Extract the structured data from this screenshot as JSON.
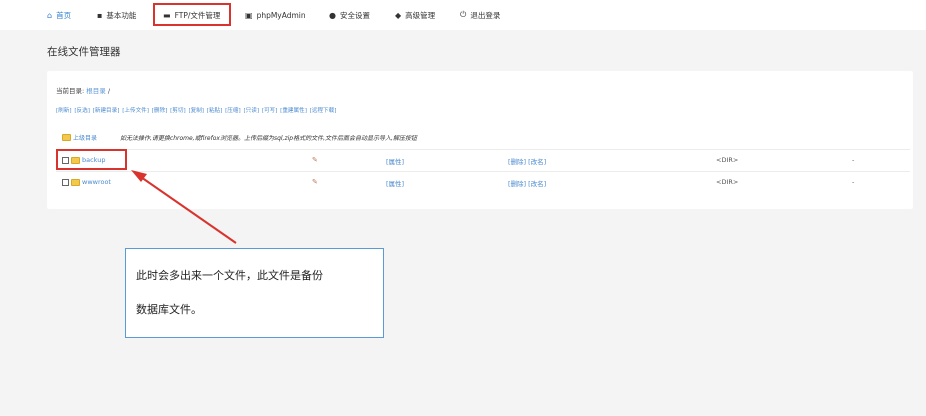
{
  "nav": {
    "items": [
      {
        "icon": "home-icon",
        "glyph": "⌂",
        "label": "首页"
      },
      {
        "icon": "grid-icon",
        "glyph": "▪",
        "label": "基本功能"
      },
      {
        "icon": "folder-icon",
        "glyph": "▬",
        "label": "FTP/文件管理"
      },
      {
        "icon": "database-icon",
        "glyph": "▣",
        "label": "phpMyAdmin"
      },
      {
        "icon": "shield-icon",
        "glyph": "●",
        "label": "安全设置"
      },
      {
        "icon": "layers-icon",
        "glyph": "◆",
        "label": "高级管理"
      },
      {
        "icon": "power-icon",
        "glyph": "⏻",
        "label": "退出登录"
      }
    ],
    "active": "FTP/文件管理"
  },
  "page_title": "在线文件管理器",
  "current_dir": {
    "label": "当前目录:",
    "root_link": "根目录",
    "sep": "/"
  },
  "toolbar": [
    "[刷新]",
    "[反选]",
    "[新建目录]",
    "[上传文件]",
    "[删除]",
    "[剪切]",
    "[复制]",
    "[粘贴]",
    "[压缩]",
    "[只读]",
    "[可写]",
    "[重建属性]",
    "[远程下载]"
  ],
  "parent_dir": {
    "label": "上级目录",
    "note": "如无法操作,请更换chrome,或firefox浏览器。上传后缀为sql,zip格式的文件,文件后面会自动显示导入,解压按钮"
  },
  "files": [
    {
      "name": "backup",
      "attr": "[属性]",
      "actions": "[删除] [改名]",
      "type": "<DIR>",
      "size": "-"
    },
    {
      "name": "wwwroot",
      "attr": "[属性]",
      "actions": "[删除] [改名]",
      "type": "<DIR>",
      "size": "-"
    }
  ],
  "callout": {
    "line1": "此时会多出来一个文件，此文件是备份",
    "line2": "数据库文件。"
  },
  "colors": {
    "highlight": "#d9332e",
    "link": "#4b8ad0",
    "callout_border": "#5b9bd5"
  }
}
